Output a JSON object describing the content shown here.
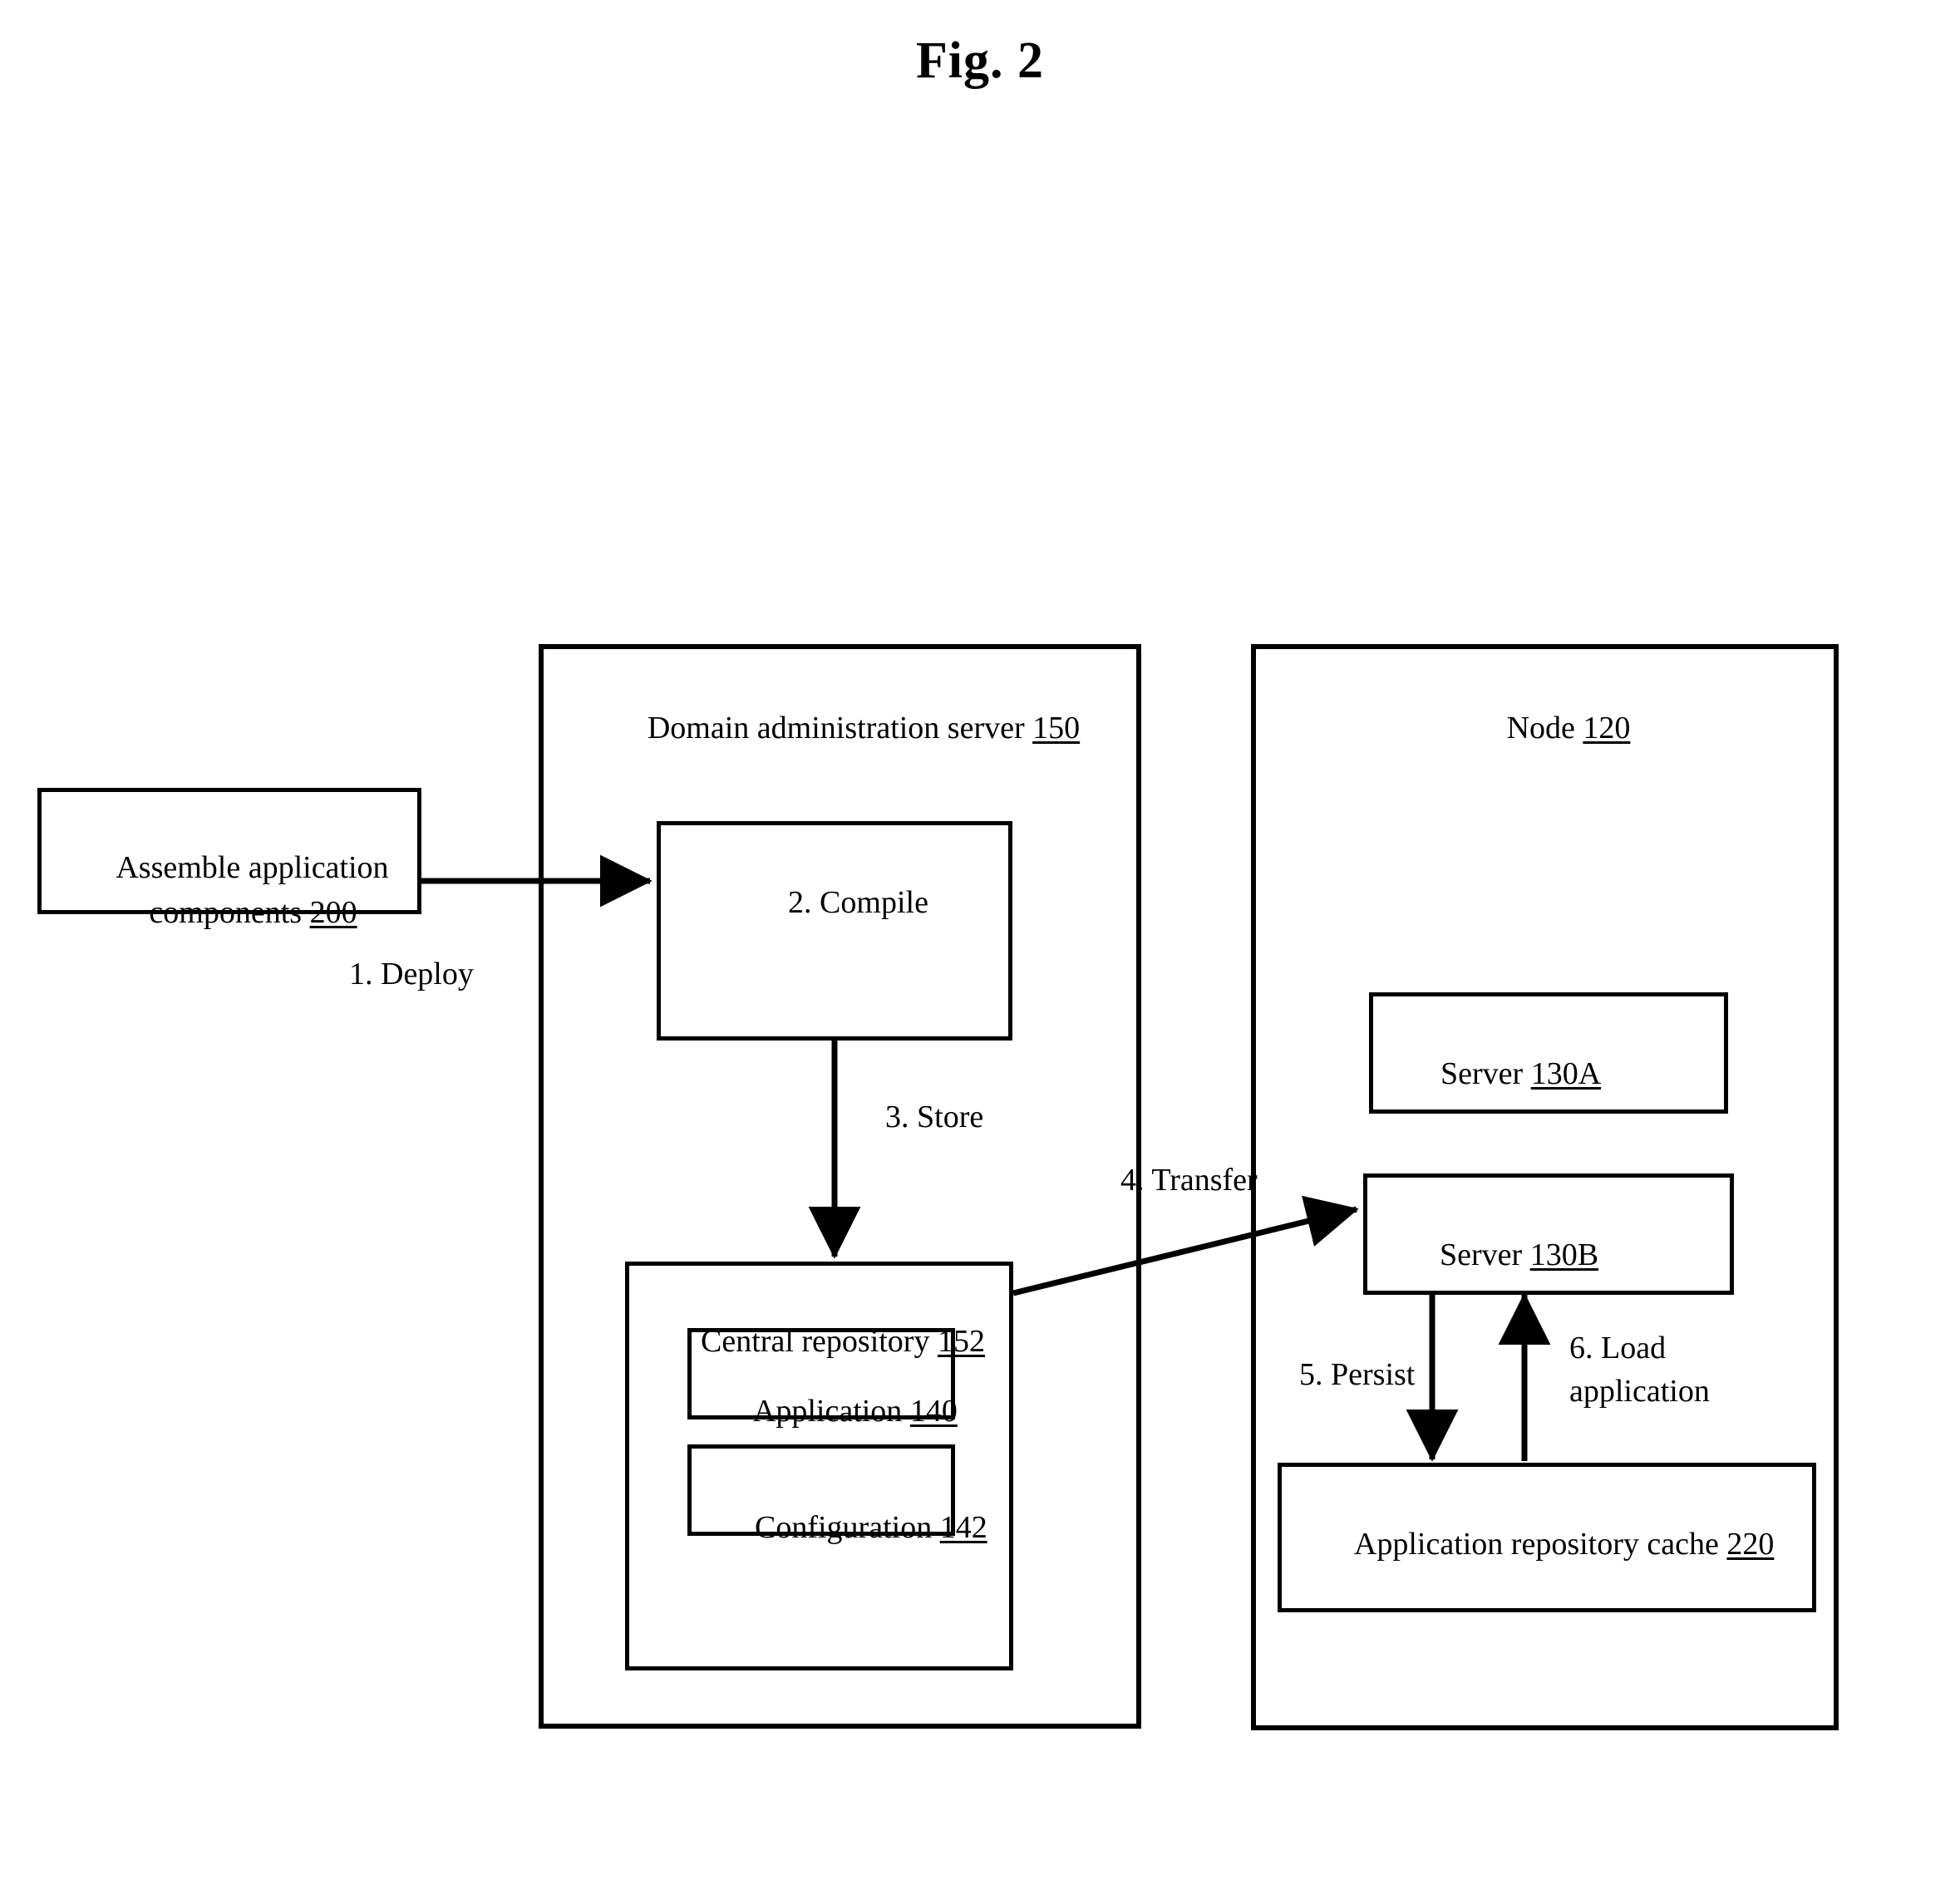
{
  "figure": {
    "title": "Fig. 2"
  },
  "nodes": {
    "assemble": {
      "line1": "Assemble application",
      "line2_text": "components ",
      "line2_ref": "200"
    },
    "das_container": {
      "label_text": "Domain administration server ",
      "label_ref": "150"
    },
    "compile": {
      "label": "2. Compile"
    },
    "central_repository": {
      "label_text": "Central repository ",
      "label_ref": "152"
    },
    "application": {
      "label_text": "Application ",
      "label_ref": "140"
    },
    "configuration": {
      "label_text": "Configuration ",
      "label_ref": "142"
    },
    "node_container": {
      "label_text": "Node ",
      "label_ref": "120"
    },
    "server_130a": {
      "label_text": "Server ",
      "label_ref": "130A"
    },
    "server_130b": {
      "label_text": "Server ",
      "label_ref": "130B"
    },
    "app_repo_cache": {
      "label_text": "Application repository cache ",
      "label_ref": "220"
    }
  },
  "flows": {
    "deploy": "1. Deploy",
    "store": "3. Store",
    "transfer": "4. Transfer",
    "persist": "5. Persist",
    "load_line1": "6. Load",
    "load_line2": "application"
  },
  "style": {
    "stroke": "#000000",
    "background": "#ffffff"
  }
}
